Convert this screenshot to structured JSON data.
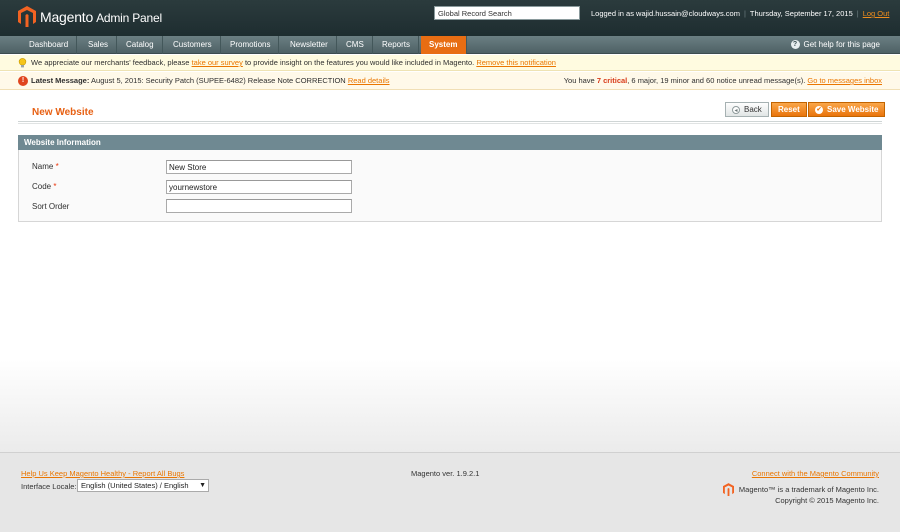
{
  "header": {
    "logo_brand": "Magento",
    "logo_suffix": "Admin Panel",
    "search_value": "Global Record Search",
    "logged_in": "Logged in as wajid.hussain@cloudways.com",
    "date": "Thursday, September 17, 2015",
    "logout": "Log Out"
  },
  "nav": {
    "items": [
      "Dashboard",
      "Sales",
      "Catalog",
      "Customers",
      "Promotions",
      "Newsletter",
      "CMS",
      "Reports",
      "System"
    ],
    "active": "System",
    "help": "Get help for this page"
  },
  "notice": {
    "text_before": "We appreciate our merchants' feedback, please",
    "survey_link": "take our survey",
    "text_after": "to provide insight on the features you would like included in Magento.",
    "remove_link": "Remove this notification"
  },
  "latest": {
    "label": "Latest Message:",
    "text": "August 5, 2015: Security Patch (SUPEE-6482) Release Note CORRECTION",
    "link": "Read details",
    "summary_pre": "You have",
    "critical": "7 critical",
    "rest": ", 6 major, 19 minor and 60 notice unread message(s).",
    "inbox_link": "Go to messages inbox"
  },
  "page": {
    "title": "New Website",
    "back": "Back",
    "reset": "Reset",
    "save": "Save Website"
  },
  "form": {
    "section_title": "Website Information",
    "name_label": "Name",
    "name_value": "New Store",
    "code_label": "Code",
    "code_value": "yournewstore",
    "sort_label": "Sort Order",
    "sort_value": "",
    "required_mark": "*"
  },
  "footer": {
    "help_link": "Help Us Keep Magento Healthy - Report All Bugs",
    "locale_label": "Interface Locale:",
    "locale_value": "English (United States) / English",
    "version": "Magento ver. 1.9.2.1",
    "community_link": "Connect with the Magento Community",
    "trademark": "Magento™ is a trademark of Magento Inc.",
    "copyright": "Copyright © 2015 Magento Inc."
  },
  "colors": {
    "accent": "#e86d13",
    "header_bg": "#1e2d30",
    "section_bg": "#6f8992"
  }
}
